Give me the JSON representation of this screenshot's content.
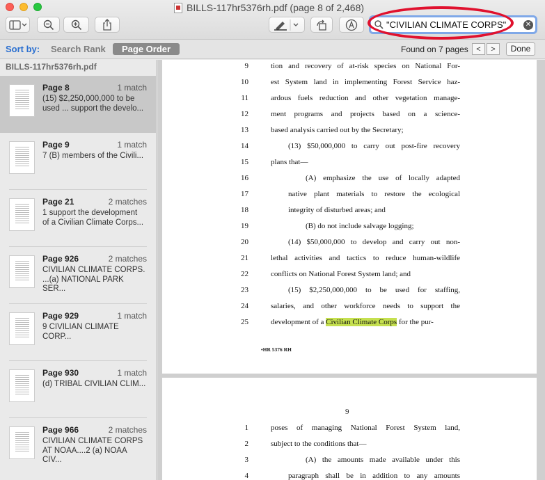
{
  "window": {
    "title": "BILLS-117hr5376rh.pdf (page 8 of 2,468)"
  },
  "search": {
    "value": "\"CIVILIAN CLIMATE CORPS\""
  },
  "sortbar": {
    "label": "Sort by:",
    "search_rank": "Search Rank",
    "page_order": "Page Order",
    "found": "Found on 7 pages",
    "prev": "<",
    "next": ">",
    "done": "Done"
  },
  "sidebar": {
    "filename": "BILLS-117hr5376rh.pdf",
    "results": [
      {
        "page": "Page 8",
        "count": "1 match",
        "line1": "(15) $2,250,000,000 to be",
        "line2": "used ... support the develo..."
      },
      {
        "page": "Page 9",
        "count": "1 match",
        "line1": "7 (B) members of the Civili...",
        "line2": ""
      },
      {
        "page": "Page 21",
        "count": "2 matches",
        "line1": "1 support the development",
        "line2": "of a Civilian Climate Corps..."
      },
      {
        "page": "Page 926",
        "count": "2 matches",
        "line1": "CIVILIAN CLIMATE CORPS.",
        "line2": "...(a) NATIONAL PARK SER..."
      },
      {
        "page": "Page 929",
        "count": "1 match",
        "line1": "9 CIVILIAN CLIMATE CORP...",
        "line2": ""
      },
      {
        "page": "Page 930",
        "count": "1 match",
        "line1": "(d) TRIBAL CIVILIAN CLIM...",
        "line2": ""
      },
      {
        "page": "Page 966",
        "count": "2 matches",
        "line1": "CIVILIAN CLIMATE CORPS",
        "line2": "AT NOAA....2 (a) NOAA CIV..."
      }
    ]
  },
  "document": {
    "page1_lines": [
      {
        "n": "9",
        "text": "tion and recovery of at-risk species on National For-"
      },
      {
        "n": "10",
        "text": "est System land in implementing Forest Service haz-"
      },
      {
        "n": "11",
        "text": "ardous fuels reduction and other vegetation manage-"
      },
      {
        "n": "12",
        "text": "ment programs and projects based on a science-"
      },
      {
        "n": "13",
        "text": "based analysis carried out by the Secretary;"
      },
      {
        "n": "14",
        "text": "(13) $50,000,000 to carry out post-fire recovery"
      },
      {
        "n": "15",
        "text": "plans that—"
      },
      {
        "n": "16",
        "text": "(A) emphasize the use of locally adapted"
      },
      {
        "n": "17",
        "text": "native plant materials to restore the ecological"
      },
      {
        "n": "18",
        "text": "integrity of disturbed areas; and"
      },
      {
        "n": "19",
        "text": "(B) do not include salvage logging;"
      },
      {
        "n": "20",
        "text": "(14) $50,000,000 to develop and carry out non-"
      },
      {
        "n": "21",
        "text": "lethal activities and tactics to reduce human-wildlife"
      },
      {
        "n": "22",
        "text": "conflicts on National Forest System land; and"
      },
      {
        "n": "23",
        "text": "(15) $2,250,000,000 to be used for staffing,"
      },
      {
        "n": "24",
        "text": "salaries, and other workforce needs to support the"
      },
      {
        "n": "25",
        "pre": "development of a ",
        "hl": "Civilian Climate Corps",
        "post": " for the pur-"
      }
    ],
    "footer": "•HR 5376 RH",
    "page2_number": "9",
    "page2_lines": [
      {
        "n": "1",
        "text": "poses of managing National Forest System land,"
      },
      {
        "n": "2",
        "text": "subject to the conditions that—"
      },
      {
        "n": "3",
        "text": "(A) the amounts made available under this"
      },
      {
        "n": "4",
        "text": "paragraph shall be in addition to any amounts"
      }
    ]
  }
}
